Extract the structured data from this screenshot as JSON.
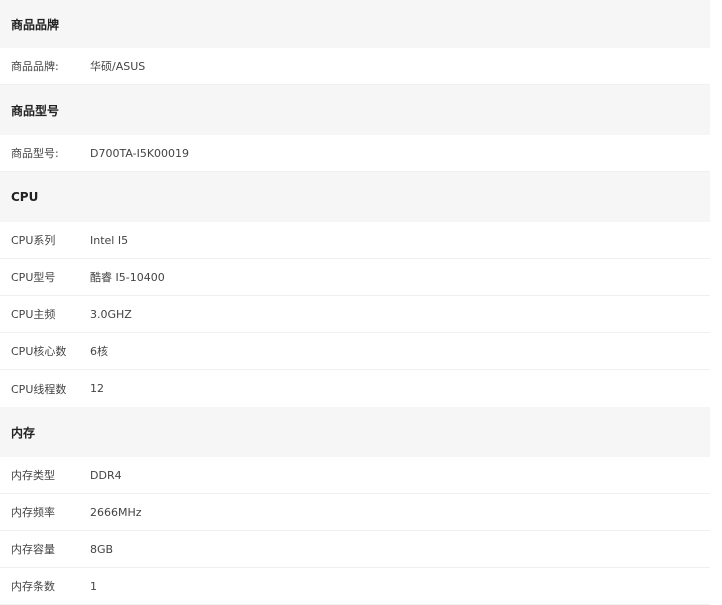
{
  "sections": [
    {
      "title": "商品品牌",
      "rows": [
        {
          "label": "商品品牌:",
          "value": "华硕/ASUS"
        }
      ]
    },
    {
      "title": "商品型号",
      "rows": [
        {
          "label": "商品型号:",
          "value": "D700TA-I5K00019"
        }
      ]
    },
    {
      "title": "CPU",
      "rows": [
        {
          "label": "CPU系列",
          "value": "Intel I5"
        },
        {
          "label": "CPU型号",
          "value": "酷睿 I5-10400"
        },
        {
          "label": "CPU主频",
          "value": "3.0GHZ"
        },
        {
          "label": "CPU核心数",
          "value": "6核"
        },
        {
          "label": "CPU线程数",
          "value": "12"
        }
      ]
    },
    {
      "title": "内存",
      "rows": [
        {
          "label": "内存类型",
          "value": "DDR4"
        },
        {
          "label": "内存频率",
          "value": "2666MHz"
        },
        {
          "label": "内存容量",
          "value": "8GB"
        },
        {
          "label": "内存条数",
          "value": "1"
        }
      ]
    }
  ]
}
